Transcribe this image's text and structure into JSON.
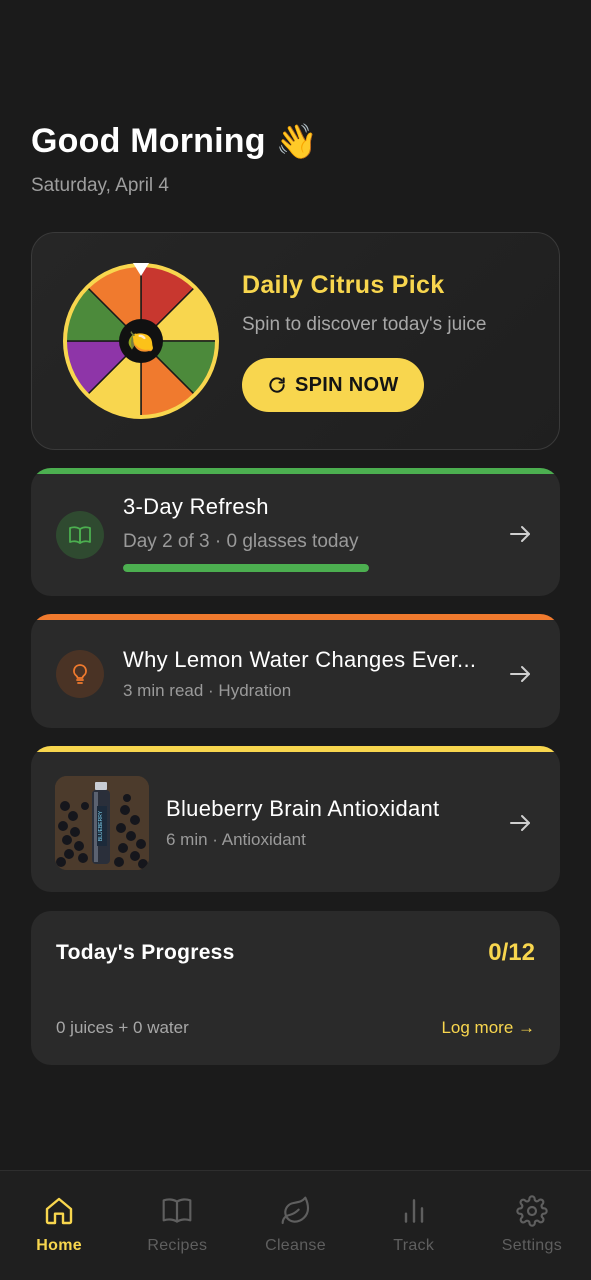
{
  "header": {
    "greeting": "Good Morning",
    "wave_emoji": "👋",
    "date": "Saturday, April 4"
  },
  "spin_card": {
    "title": "Daily Citrus Pick",
    "subtitle": "Spin to discover today's juice",
    "button_label": "SPIN NOW",
    "center_emoji": "🍋",
    "wheel_colors": [
      "#c8372f",
      "#f8d64e",
      "#4c8a3b",
      "#f07a2e",
      "#f8d64e",
      "#8e35a8",
      "#4c8a3b",
      "#f07a2e"
    ]
  },
  "cleanse_card": {
    "title": "3-Day Refresh",
    "subtitle": "Day 2 of 3 · 0 glasses today",
    "progress": 1.0,
    "accent": "#4caf50",
    "icon": "book-icon"
  },
  "article_card": {
    "title": "Why Lemon Water Changes Ever...",
    "subtitle": "3 min read · Hydration",
    "accent": "#f07a2e",
    "icon": "lightbulb-icon"
  },
  "recipe_card": {
    "title": "Blueberry Brain Antioxidant",
    "subtitle": "6 min · Antioxidant",
    "accent": "#f8d64e",
    "bottle_label": "BLUEBERRY"
  },
  "progress_card": {
    "title": "Today's Progress",
    "count": "0/12",
    "summary": "0 juices + 0 water",
    "link": "Log more →"
  },
  "nav": {
    "items": [
      {
        "label": "Home",
        "icon": "home-icon",
        "active": true
      },
      {
        "label": "Recipes",
        "icon": "book-icon",
        "active": false
      },
      {
        "label": "Cleanse",
        "icon": "leaf-icon",
        "active": false
      },
      {
        "label": "Track",
        "icon": "bar-chart-icon",
        "active": false
      },
      {
        "label": "Settings",
        "icon": "gear-icon",
        "active": false
      }
    ]
  }
}
